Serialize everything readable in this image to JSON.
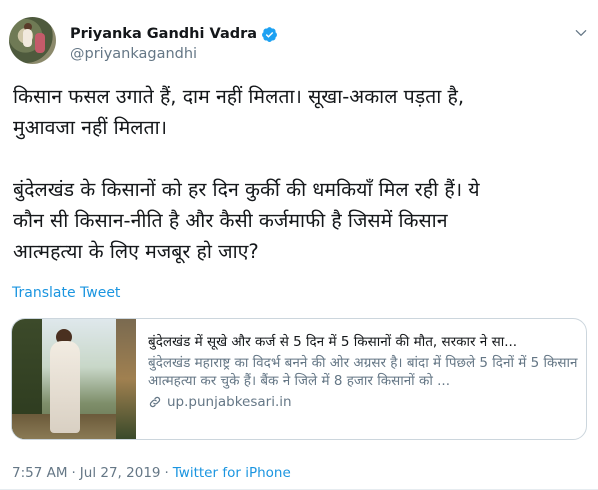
{
  "author": {
    "display_name": "Priyanka Gandhi Vadra",
    "handle": "@priyankagandhi",
    "verified": true
  },
  "tweet": {
    "text": "किसान फसल उगाते हैं, दाम नहीं मिलता। सूखा-अकाल पड़ता है,\nमुआवजा नहीं मिलता।\n\nबुंदेलखंड के किसानों को हर दिन कुर्की की धमकियाँ मिल रही हैं। ये\nकौन सी किसान-नीति है और कैसी कर्जमाफी है जिसमें किसान\nआत्महत्या के लिए मजबूर हो जाए?"
  },
  "translate_label": "Translate Tweet",
  "card": {
    "title": "बुंदेलखंड में सूखे और कर्ज से 5 दिन में 5 किसानों की मौत, सरकार ने सा...",
    "description": "बुंदेलखंड महाराष्ट्र का विदर्भ बनने की ओर अग्रसर है। बांदा में पिछले 5 दिनों में 5 किसान आत्महत्या कर चुके हैं। बैंक ने जिले में 8 हजार किसानों को ...",
    "domain": "up.punjabkesari.in"
  },
  "meta": {
    "time": "7:57 AM",
    "separator": "·",
    "date": "Jul 27, 2019",
    "client": "Twitter for iPhone"
  },
  "colors": {
    "link_blue": "#1b95e0",
    "secondary_text": "#657786",
    "border": "#ccd6dd"
  }
}
